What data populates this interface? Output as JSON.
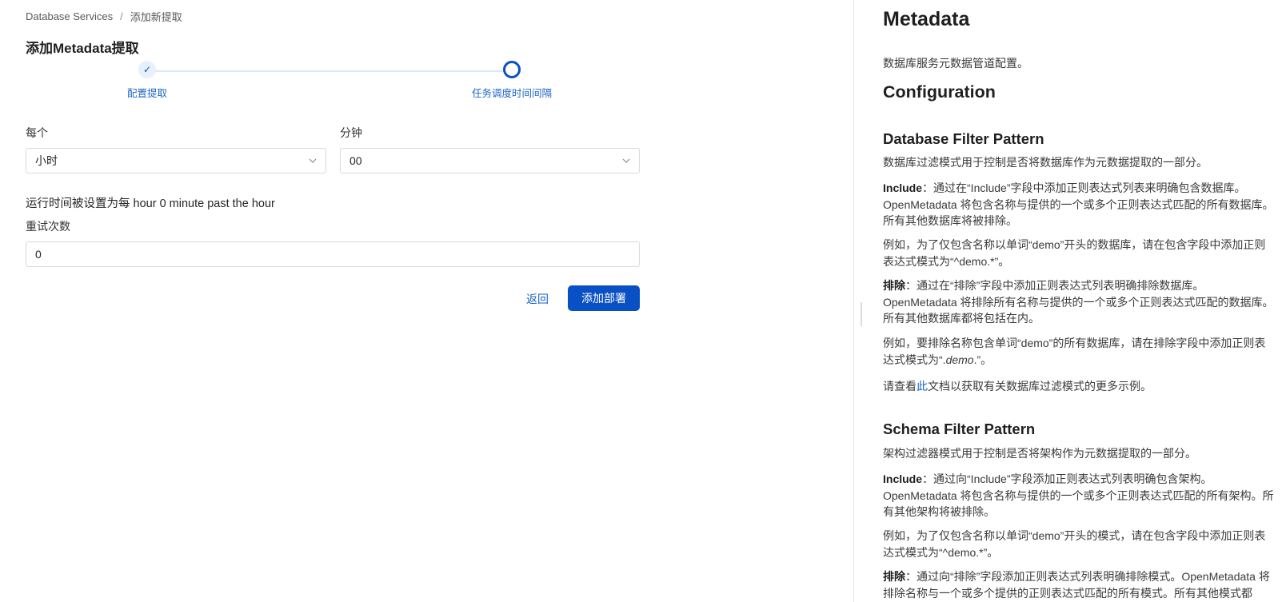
{
  "breadcrumb": {
    "root": "Database Services",
    "separator": "/",
    "current": "添加新提取"
  },
  "page_title": "添加Metadata提取",
  "stepper": {
    "steps": [
      {
        "label": "配置提取",
        "state": "done",
        "icon": "check-icon"
      },
      {
        "label": "任务调度时间间隔",
        "state": "active",
        "icon": "circle-icon"
      }
    ]
  },
  "form": {
    "every_label": "每个",
    "every_value": "小时",
    "minute_label": "分钟",
    "minute_value": "00",
    "run_text": "运行时间被设置为每 hour 0 minute past the hour",
    "retries_label": "重试次数",
    "retries_value": "0",
    "back_label": "返回",
    "submit_label": "添加部署"
  },
  "docs": {
    "title": "Metadata",
    "intro": "数据库服务元数据管道配置。",
    "config_heading": "Configuration",
    "db_filter": {
      "heading": "Database Filter Pattern",
      "desc": "数据库过滤模式用于控制是否将数据库作为元数据提取的一部分。",
      "include_label": "Include",
      "include_text": "：通过在“Include”字段中添加正则表达式列表来明确包含数据库。OpenMetadata 将包含名称与提供的一个或多个正则表达式匹配的所有数据库。所有其他数据库将被排除。",
      "include_example": "例如，为了仅包含名称以单词“demo”开头的数据库，请在包含字段中添加正则表达式模式为“^demo.*”。",
      "exclude_label": "排除",
      "exclude_text": "：通过在“排除”字段中添加正则表达式列表明确排除数据库。OpenMetadata 将排除所有名称与提供的一个或多个正则表达式匹配的数据库。所有其他数据库都将包括在内。",
      "exclude_example_pre": "例如，要排除名称包含单词“demo”的所有数据库，请在排除字段中添加正则表达式模式为“.",
      "exclude_example_em": "demo",
      "exclude_example_post": ".”。",
      "see_pre": "请查看",
      "see_link": "此",
      "see_post": "文档以获取有关数据库过滤模式的更多示例。"
    },
    "schema_filter": {
      "heading": "Schema Filter Pattern",
      "desc": "架构过滤器模式用于控制是否将架构作为元数据提取的一部分。",
      "include_label": "Include",
      "include_text": "：通过向“Include”字段添加正则表达式列表明确包含架构。OpenMetadata 将包含名称与提供的一个或多个正则表达式匹配的所有架构。所有其他架构将被排除。",
      "include_example": "例如，为了仅包含名称以单词“demo”开头的模式，请在包含字段中添加正则表达式模式为“^demo.*”。",
      "exclude_label": "排除",
      "exclude_text": "：通过向“排除”字段添加正则表达式列表明确排除模式。OpenMetadata 将排除名称与一个或多个提供的正则表达式匹配的所有模式。所有其他模式都"
    }
  }
}
